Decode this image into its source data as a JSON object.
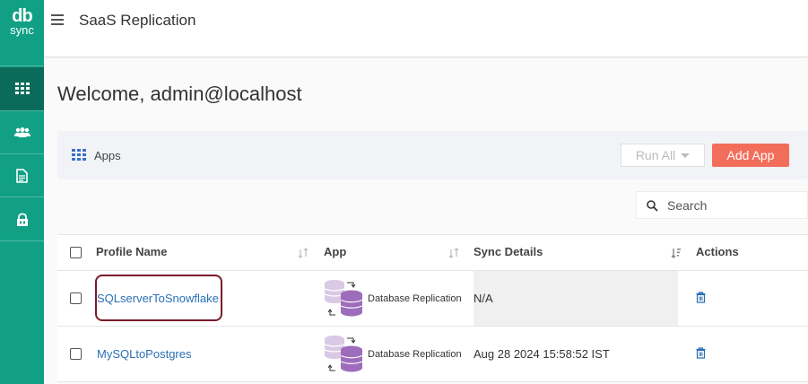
{
  "brand": {
    "logo_line1": "db",
    "logo_line2": "sync"
  },
  "nav": [
    {
      "name": "apps",
      "icon": "grid-icon"
    },
    {
      "name": "users",
      "icon": "users-icon"
    },
    {
      "name": "docs",
      "icon": "document-icon"
    },
    {
      "name": "security",
      "icon": "lock-icon"
    }
  ],
  "header": {
    "title": "SaaS Replication"
  },
  "page": {
    "welcome": "Welcome, admin@localhost"
  },
  "panel": {
    "label": "Apps",
    "run_all_label": "Run All",
    "add_app_label": "Add App"
  },
  "search": {
    "placeholder": "Search"
  },
  "table": {
    "columns": [
      "Profile Name",
      "App",
      "Sync Details",
      "Actions"
    ],
    "rows": [
      {
        "profile": "SQLserverToSnowflake",
        "app": "Database Replication",
        "sync": "N/A"
      },
      {
        "profile": "MySQLtoPostgres",
        "app": "Database Replication",
        "sync": "Aug 28 2024 15:58:52 IST"
      }
    ]
  },
  "colors": {
    "sidebar": "#12a085",
    "sidebar_active": "#0b6b5a",
    "accent": "#f26e5b",
    "link": "#2a6fb3"
  }
}
